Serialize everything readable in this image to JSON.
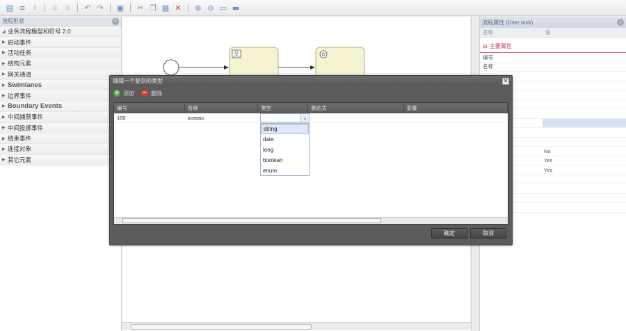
{
  "left_panel": {
    "title": "流程形状",
    "items": [
      {
        "label": "业务流程模型和符号 2.0",
        "expanded": true,
        "big": false
      },
      {
        "label": "启动事件",
        "expanded": false,
        "big": false
      },
      {
        "label": "活动任务",
        "expanded": false,
        "big": false
      },
      {
        "label": "结构元素",
        "expanded": false,
        "big": false
      },
      {
        "label": "网关通道",
        "expanded": false,
        "big": false
      },
      {
        "label": "Swimlanes",
        "expanded": false,
        "big": true
      },
      {
        "label": "边界事件",
        "expanded": false,
        "big": false
      },
      {
        "label": "Boundary Events",
        "expanded": false,
        "big": true
      },
      {
        "label": "中间捕获事件",
        "expanded": false,
        "big": false
      },
      {
        "label": "中间投掷事件",
        "expanded": false,
        "big": false
      },
      {
        "label": "结束事件",
        "expanded": false,
        "big": false
      },
      {
        "label": "连接对象",
        "expanded": false,
        "big": false
      },
      {
        "label": "其它元素",
        "expanded": false,
        "big": false
      }
    ]
  },
  "right_panel": {
    "title": "流程属性 (User task)",
    "col_name": "名称",
    "col_value": "值",
    "group": "主要属性",
    "rows": [
      {
        "key": "编号",
        "value": ""
      },
      {
        "key": "名称",
        "value": ""
      },
      {
        "key": "",
        "value": ""
      },
      {
        "key": "",
        "value": ""
      },
      {
        "key": "",
        "value": ""
      },
      {
        "key": "",
        "value": ""
      },
      {
        "key": "",
        "value": ""
      },
      {
        "key": "",
        "value": ""
      },
      {
        "key": "",
        "value": ""
      },
      {
        "key": "",
        "value": ""
      },
      {
        "key": "us",
        "value": "No"
      },
      {
        "key": "",
        "value": "Yes"
      },
      {
        "key": "lulti-insta...",
        "value": "Yes"
      },
      {
        "key": "lulti-insta...",
        "value": ""
      },
      {
        "key": "ulti-insta...",
        "value": ""
      },
      {
        "key": "able (Mult...",
        "value": ""
      },
      {
        "key": "ondition (...",
        "value": ""
      }
    ]
  },
  "dialog": {
    "title": "编辑一个复杂的类型",
    "add_label": "添加",
    "delete_label": "删除",
    "columns": [
      "编号",
      "名称",
      "类型",
      "表达式",
      "变量"
    ],
    "rows": [
      {
        "id": "100",
        "name": "scasas",
        "type": "",
        "expr": "",
        "var": ""
      }
    ],
    "ok_label": "确定",
    "cancel_label": "取消",
    "type_options": [
      "string",
      "date",
      "long",
      "boolean",
      "enum"
    ],
    "highlighted_option": "string"
  },
  "icons": {
    "collapse_left": "double-chevron-left-icon",
    "collapse_right": "double-chevron-right-icon",
    "close": "close-icon",
    "add": "plus-icon",
    "delete": "minus-icon",
    "dropdown": "chevron-down-icon"
  },
  "colors": {
    "accent_pink": "#c23b6a",
    "task_fill": "#f5f3d2",
    "dialog_bg": "#5c5c5c"
  }
}
